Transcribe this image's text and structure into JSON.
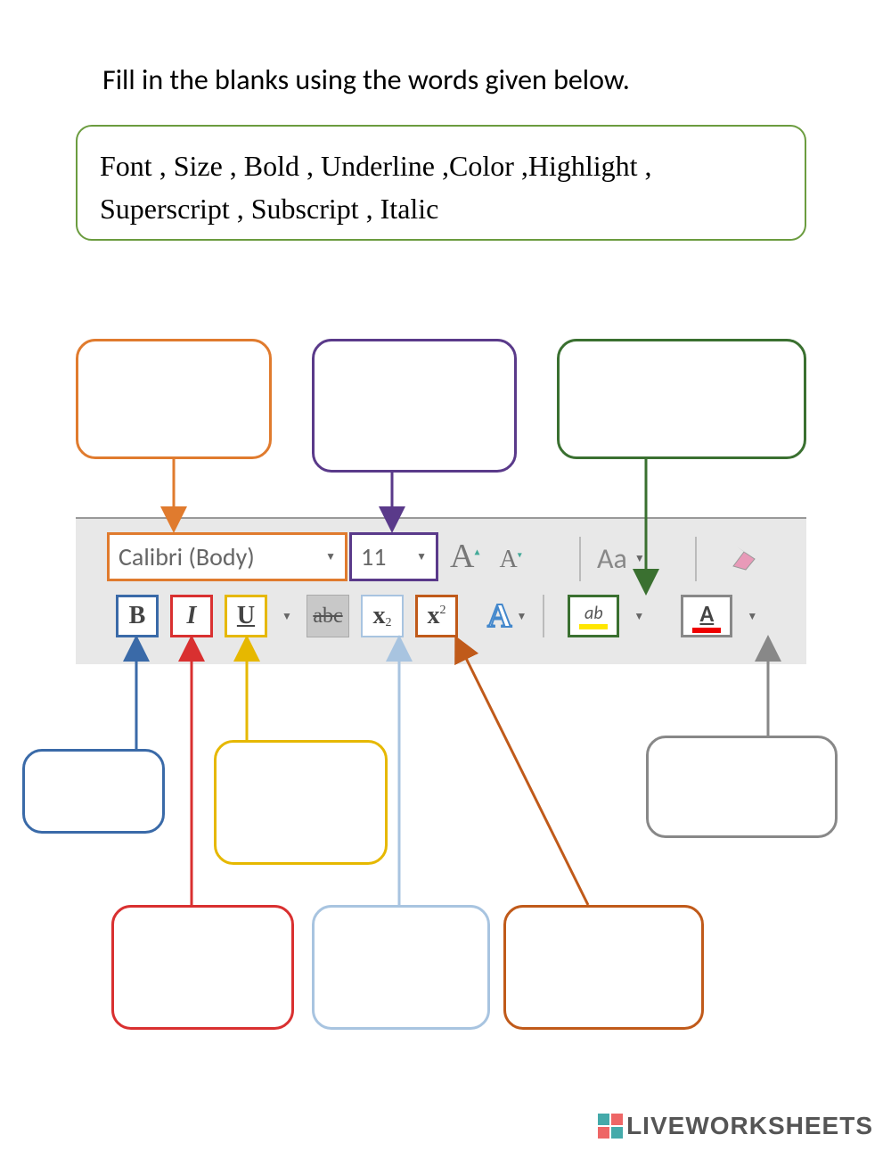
{
  "instruction": "Fill in the blanks using the words given below.",
  "word_bank": "Font , Size , Bold , Underline ,Color ,Highlight , Superscript , Subscript , Italic",
  "ribbon": {
    "font_name": "Calibri (Body)",
    "font_size": "11",
    "grow_letter": "A",
    "shrink_letter": "A",
    "change_case": "Aa",
    "bold": "B",
    "italic": "I",
    "underline": "U",
    "strike": "abc",
    "subscript_base": "x",
    "subscript_ind": "2",
    "superscript_base": "x",
    "superscript_ind": "2",
    "text_effects_letter": "A",
    "highlight_label": "ab",
    "font_color_letter": "A"
  },
  "blank_answers": {
    "font": "",
    "size": "",
    "highlight": "",
    "bold": "",
    "italic": "",
    "underline": "",
    "subscript": "",
    "superscript": "",
    "color": ""
  },
  "colors": {
    "orange": "#e07b2e",
    "purple": "#5a3a8a",
    "green": "#3a7030",
    "blue": "#3a6aa8",
    "red": "#d93030",
    "yellow": "#e6b800",
    "lightblue": "#a8c4e0",
    "brown": "#c05a1a",
    "gray": "#888888"
  },
  "watermark": "LIVEWORKSHEETS"
}
